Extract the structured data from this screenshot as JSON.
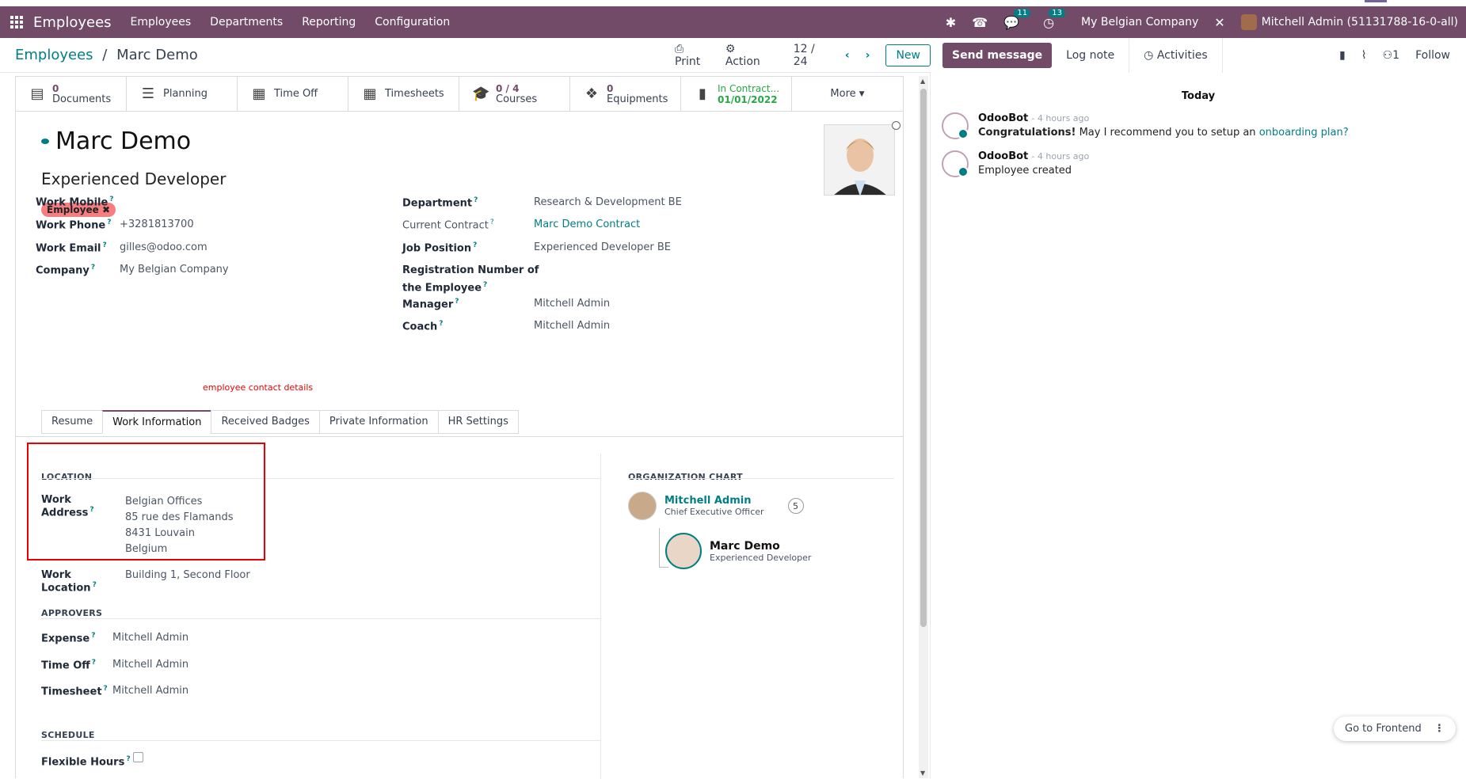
{
  "navbar": {
    "brand": "Employees",
    "menus": [
      "Employees",
      "Departments",
      "Reporting",
      "Configuration"
    ],
    "chat_count": "11",
    "activity_count": "13",
    "company": "My Belgian Company",
    "user": "Mitchell Admin (51131788-16-0-all)"
  },
  "breadcrumb": {
    "parent": "Employees",
    "sep": "/",
    "current": "Marc Demo"
  },
  "actions": {
    "print": "Print",
    "action": "Action",
    "pager": "12 / 24",
    "new": "New"
  },
  "smart_buttons": [
    {
      "num": "0",
      "label": "Documents"
    },
    {
      "num": "",
      "label": "Planning"
    },
    {
      "num": "",
      "label": "Time Off"
    },
    {
      "num": "",
      "label": "Timesheets"
    },
    {
      "num": "0 / 4",
      "label": "Courses"
    },
    {
      "num": "0",
      "label": "Equipments"
    },
    {
      "num": "In Contract...",
      "label": "01/01/2022"
    }
  ],
  "more": "More",
  "employee": {
    "name": "Marc Demo",
    "job_title": "Experienced Developer",
    "tag": "Employee"
  },
  "fields_left": {
    "work_mobile": {
      "label": "Work Mobile",
      "value": ""
    },
    "work_phone": {
      "label": "Work Phone",
      "value": "+3281813700"
    },
    "work_email": {
      "label": "Work Email",
      "value": "gilles@odoo.com"
    },
    "company": {
      "label": "Company",
      "value": "My Belgian Company"
    }
  },
  "fields_right": {
    "department": {
      "label": "Department",
      "value": "Research & Development BE"
    },
    "current_contract": {
      "label": "Current Contract",
      "value": "Marc Demo Contract"
    },
    "job_position": {
      "label": "Job Position",
      "value": "Experienced Developer BE"
    },
    "registration_line1": "Registration Number of",
    "registration_line2": "the Employee",
    "manager": {
      "label": "Manager",
      "value": "Mitchell Admin"
    },
    "coach": {
      "label": "Coach",
      "value": "Mitchell Admin"
    }
  },
  "annotation": "employee contact details",
  "tabs": [
    "Resume",
    "Work Information",
    "Received Badges",
    "Private Information",
    "HR Settings"
  ],
  "location": {
    "title": "LOCATION",
    "work_address_label": "Work Address",
    "address": [
      "Belgian Offices",
      "85 rue des Flamands",
      "8431 Louvain",
      "Belgium"
    ],
    "work_location_label": "Work Location",
    "work_location": "Building 1, Second Floor"
  },
  "approvers": {
    "title": "APPROVERS",
    "expense": {
      "label": "Expense",
      "value": "Mitchell Admin"
    },
    "time_off": {
      "label": "Time Off",
      "value": "Mitchell Admin"
    },
    "timesheet": {
      "label": "Timesheet",
      "value": "Mitchell Admin"
    }
  },
  "schedule": {
    "title": "SCHEDULE",
    "flexible_label": "Flexible Hours"
  },
  "org_chart": {
    "title": "ORGANIZATION CHART",
    "manager_name": "Mitchell Admin",
    "manager_title": "Chief Executive Officer",
    "count": "5",
    "self_name": "Marc Demo",
    "self_title": "Experienced Developer"
  },
  "chatter": {
    "send": "Send message",
    "log": "Log note",
    "activities": "Activities",
    "followers": "1",
    "follow": "Follow",
    "today": "Today",
    "messages": [
      {
        "author": "OdooBot",
        "time": "- 4 hours ago",
        "bold": "Congratulations!",
        "text": " May I recommend you to setup an ",
        "link": "onboarding plan?"
      },
      {
        "author": "OdooBot",
        "time": "- 4 hours ago",
        "text": "Employee created"
      }
    ]
  },
  "go_frontend": "Go to Frontend",
  "colors": {
    "brand": "#714b67",
    "accent": "#017e84",
    "tag": "#f67e80",
    "annotation": "#e00000"
  }
}
